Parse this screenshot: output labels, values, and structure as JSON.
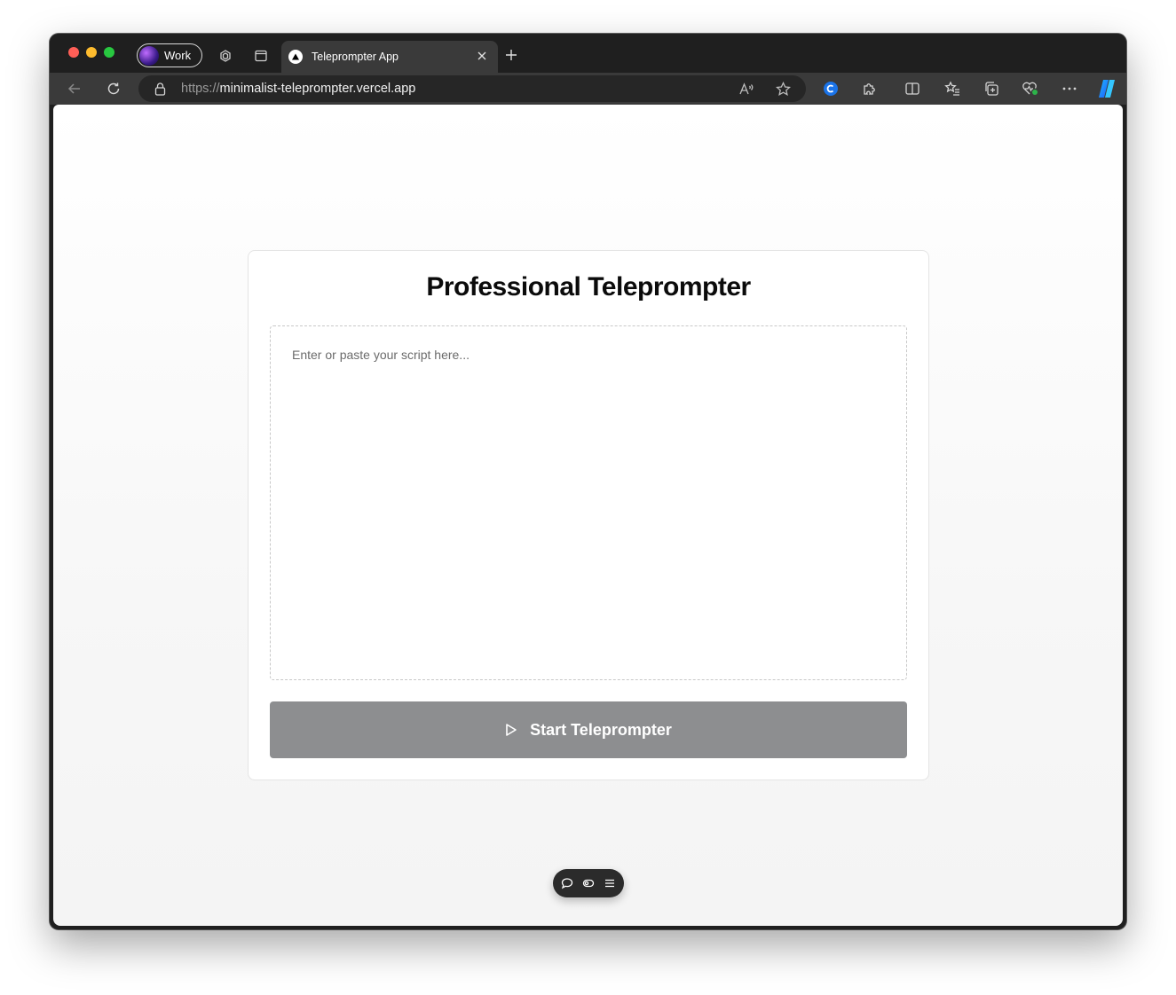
{
  "browser": {
    "profile_label": "Work",
    "tab_title": "Teleprompter App",
    "url_protocol": "https://",
    "url_host": "minimalist-teleprompter.vercel.app"
  },
  "app": {
    "title": "Professional Teleprompter",
    "script_placeholder": "Enter or paste your script here...",
    "start_button_label": "Start Teleprompter"
  },
  "colors": {
    "start_button_bg": "#8d8e90",
    "browser_chrome": "#1f1f1f",
    "toolbar": "#3a3a3a"
  }
}
